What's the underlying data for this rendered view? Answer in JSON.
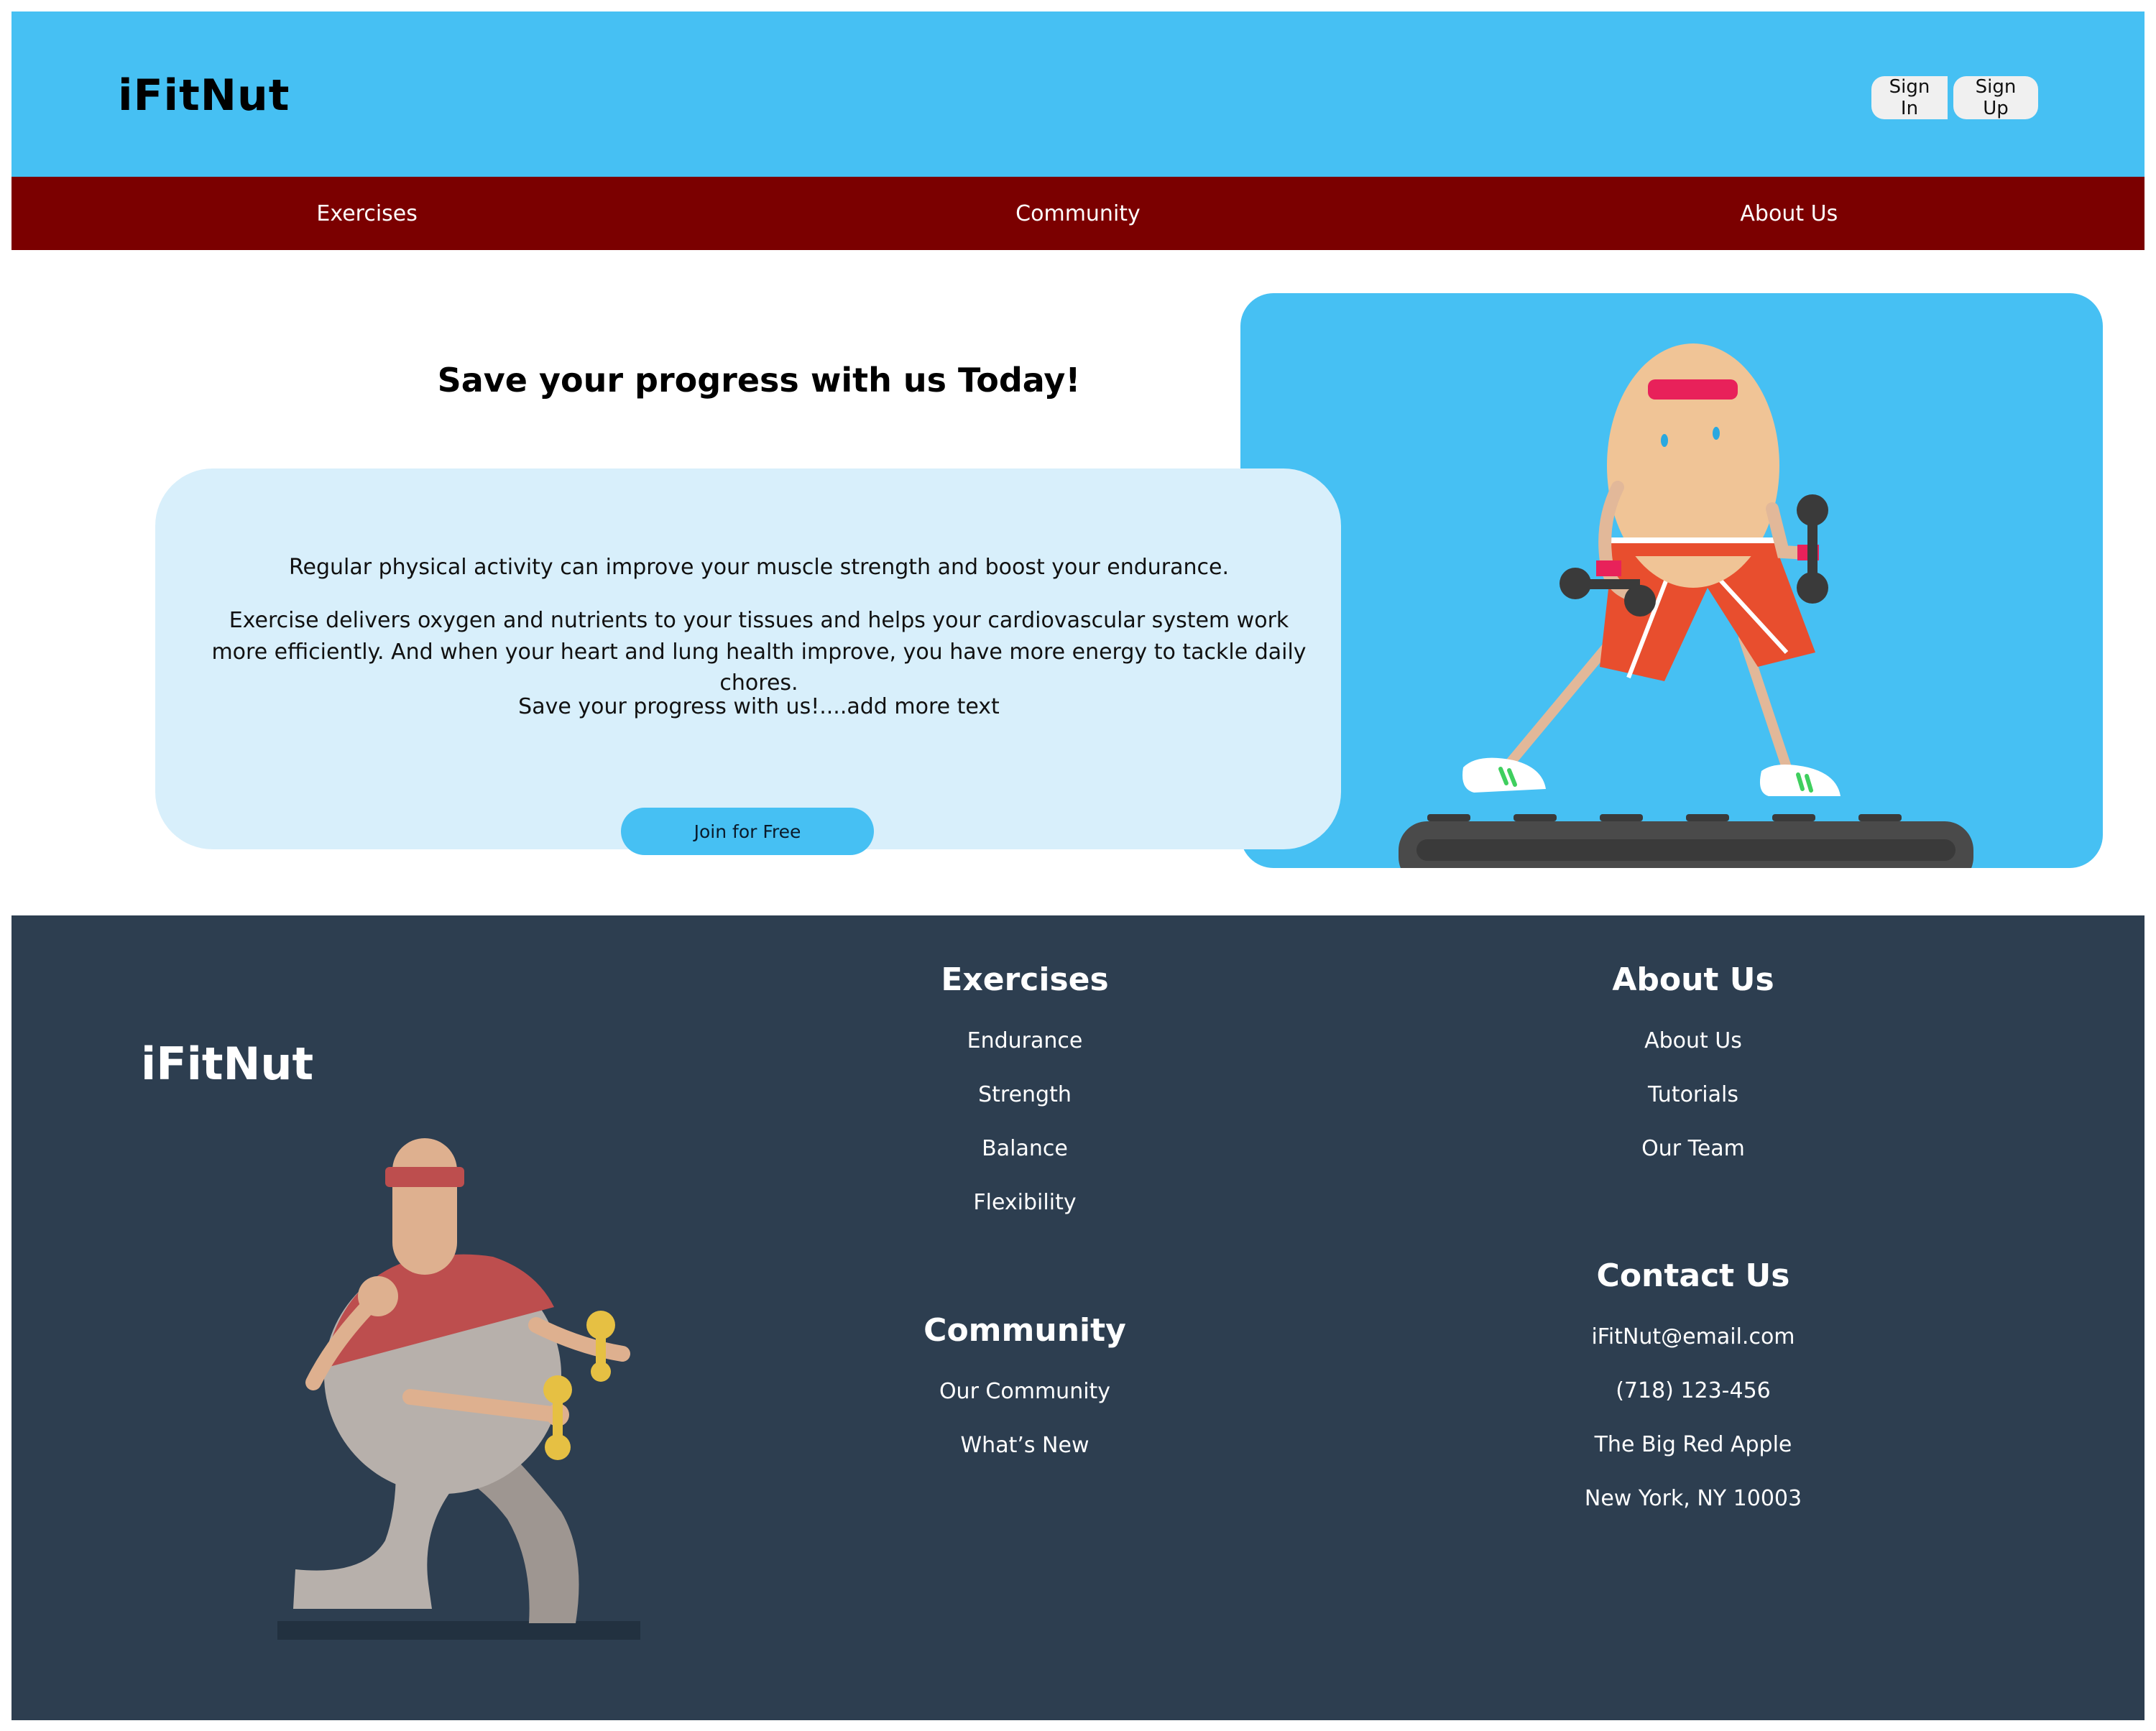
{
  "header": {
    "logo": "iFitNut",
    "sign_in": "Sign In",
    "sign_up": "Sign Up"
  },
  "nav": {
    "items": [
      "Exercises",
      "Community",
      "About Us"
    ]
  },
  "hero": {
    "title": "Save your progress with us Today!",
    "paragraphs": [
      "Regular physical activity can improve your muscle strength and boost your endurance.",
      "Exercise delivers oxygen and nutrients to your tissues and helps your cardiovascular system work more efficiently. And when your heart and lung health improve, you have more energy to tackle daily chores.",
      "Save your progress with us!....add more text"
    ],
    "cta": "Join for Free"
  },
  "footer": {
    "logo": "iFitNut",
    "exercises": {
      "heading": "Exercises",
      "links": [
        "Endurance",
        "Strength",
        "Balance",
        "Flexibility"
      ]
    },
    "community": {
      "heading": "Community",
      "links": [
        "Our Community",
        "What’s New"
      ]
    },
    "about": {
      "heading": "About Us",
      "links": [
        "About Us",
        "Tutorials",
        "Our Team"
      ]
    },
    "contact": {
      "heading": "Contact Us",
      "lines": [
        "iFitNut@email.com",
        "(718) 123-456",
        "The Big Red Apple",
        "New York, NY 10003"
      ]
    }
  },
  "colors": {
    "header_bg": "#46c0f3",
    "nav_bg": "#7b0000",
    "card_bg": "#d8effb",
    "footer_bg": "#2d3e50"
  }
}
